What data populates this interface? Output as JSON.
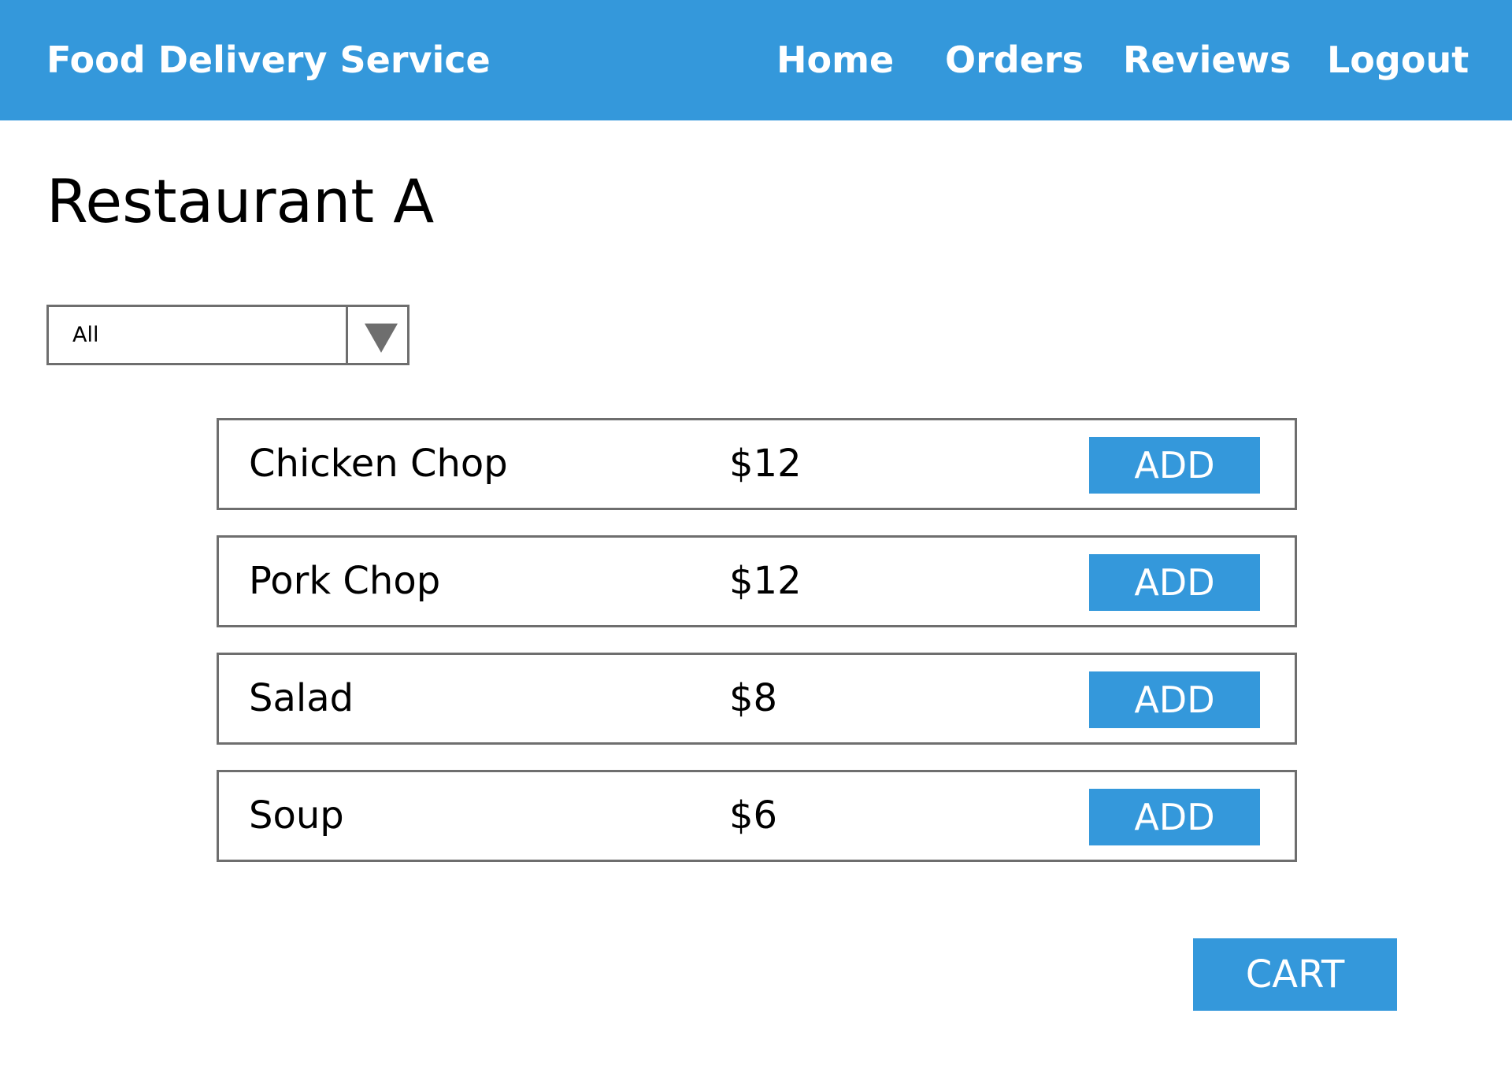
{
  "header": {
    "brand": "Food Delivery Service",
    "nav": [
      "Home",
      "Orders",
      "Reviews",
      "Logout"
    ]
  },
  "page": {
    "title": "Restaurant A"
  },
  "filter": {
    "selected": "All"
  },
  "menu": {
    "items": [
      {
        "name": "Chicken Chop",
        "price": "$12",
        "action": "ADD"
      },
      {
        "name": "Pork Chop",
        "price": "$12",
        "action": "ADD"
      },
      {
        "name": "Salad",
        "price": "$8",
        "action": "ADD"
      },
      {
        "name": "Soup",
        "price": "$6",
        "action": "ADD"
      }
    ]
  },
  "cart": {
    "label": "CART"
  },
  "colors": {
    "accent": "#3498db",
    "border": "#6e6e6e",
    "text": "#000000",
    "background": "#ffffff"
  }
}
